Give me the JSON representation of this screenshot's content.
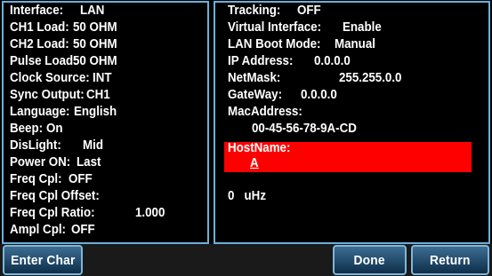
{
  "left_panel": {
    "rows": [
      {
        "label": "Interface:",
        "value": "LAN"
      },
      {
        "label": "CH1 Load:",
        "value": "50 OHM"
      },
      {
        "label": "CH2 Load:",
        "value": "50 OHM"
      },
      {
        "label": "Pulse Load:",
        "value": "50 OHM"
      },
      {
        "label": "Clock Source:",
        "value": "INT"
      },
      {
        "label": "Sync Output:",
        "value": "CH1"
      },
      {
        "label": "Language:",
        "value": "English"
      },
      {
        "label": "Beep:",
        "value": "On"
      },
      {
        "label": "DisLight:",
        "value": "Mid"
      },
      {
        "label": "Power ON:",
        "value": "Last"
      },
      {
        "label": "Freq Cpl:",
        "value": "OFF"
      },
      {
        "label": "Freq Cpl Offset:",
        "value": ""
      },
      {
        "label": "Freq Cpl Ratio:",
        "value": "1.000"
      },
      {
        "label": "Ampl Cpl:",
        "value": "OFF"
      }
    ]
  },
  "right_panel": {
    "tracking": {
      "label": "Tracking:",
      "value": "OFF"
    },
    "virtual_interface": {
      "label": "Virtual Interface:",
      "value": "Enable"
    },
    "lan_boot_mode": {
      "label": "LAN Boot Mode:",
      "value": "Manual"
    },
    "ip_address": {
      "label": "IP Address:",
      "value": "0.0.0.0"
    },
    "netmask": {
      "label": "NetMask:",
      "value": "255.255.0.0"
    },
    "gateway": {
      "label": "GateWay:",
      "value": "0.0.0.0"
    },
    "mac_address": {
      "label": "MacAddress:",
      "value": "00-45-56-78-9A-CD"
    },
    "hostname": {
      "label": "HostName:",
      "value": "A"
    },
    "freq_offset_value": "0   uHz"
  },
  "softkeys": {
    "enter_char": "Enter Char",
    "done": "Done",
    "return": "Return"
  },
  "colors": {
    "background": "#000000",
    "panel_border": "#6ab0d8",
    "highlight": "#ff0000",
    "softkey": "#1f4d74"
  }
}
